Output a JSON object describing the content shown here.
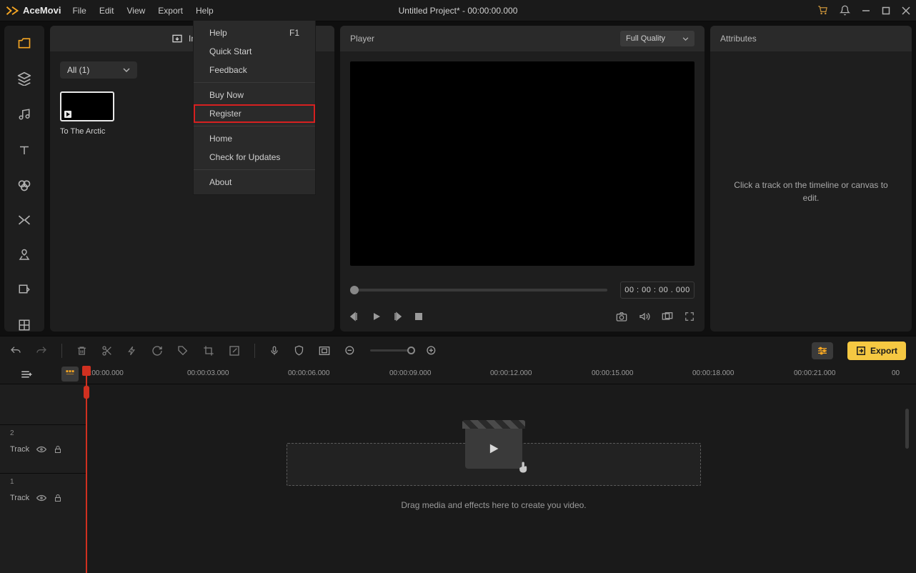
{
  "app": {
    "name": "AceMovi",
    "title": "Untitled Project* - 00:00:00.000"
  },
  "menu": {
    "file": "File",
    "edit": "Edit",
    "view": "View",
    "export": "Export",
    "help": "Help"
  },
  "helpMenu": {
    "help": "Help",
    "helpShortcut": "F1",
    "quickStart": "Quick Start",
    "feedback": "Feedback",
    "buyNow": "Buy Now",
    "register": "Register",
    "home": "Home",
    "checkUpdates": "Check for Updates",
    "about": "About"
  },
  "media": {
    "importLabel": "Import",
    "filter": "All (1)",
    "clipName": "To The Arctic"
  },
  "player": {
    "title": "Player",
    "quality": "Full Quality",
    "time": "00 : 00 : 00 . 000"
  },
  "attributes": {
    "title": "Attributes",
    "placeholder": "Click a track on the timeline or canvas to edit."
  },
  "toolbar": {
    "export": "Export"
  },
  "timeline": {
    "marks": [
      "0:00:00.000",
      "00:00:03.000",
      "00:00:06.000",
      "00:00:09.000",
      "00:00:12.000",
      "00:00:15.000",
      "00:00:18.000",
      "00:00:21.000",
      "00"
    ],
    "track1": {
      "num": "2",
      "label": "Track"
    },
    "track2": {
      "num": "1",
      "label": "Track"
    },
    "dropText": "Drag media and effects here to create you video."
  }
}
